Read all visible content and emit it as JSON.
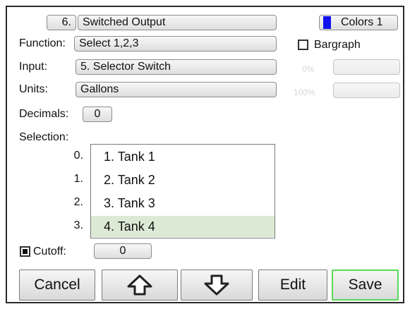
{
  "header": {
    "output_number": "6.",
    "output_name": "Switched Output",
    "colors_label": "Colors 1",
    "colors_swatch": "#1010ee"
  },
  "function": {
    "label": "Function:",
    "value": "Select 1,2,3"
  },
  "bargraph": {
    "label": "Bargraph",
    "checked": false
  },
  "input": {
    "label": "Input:",
    "value": "5. Selector Switch"
  },
  "units": {
    "label": "Units:",
    "value": "Gallons"
  },
  "range": {
    "low_label": "0%",
    "high_label": "100%",
    "low_value": "",
    "high_value": ""
  },
  "decimals": {
    "label": "Decimals:",
    "value": "0"
  },
  "selection": {
    "label": "Selection:",
    "indexes": [
      "0.",
      "1.",
      "2.",
      "3."
    ],
    "items": [
      "1. Tank 1",
      "2. Tank 2",
      "3. Tank 3",
      "4. Tank 4"
    ],
    "selected_index": 3
  },
  "cutoff": {
    "label": "Cutoff:",
    "checked": true,
    "value": "0"
  },
  "buttons": {
    "cancel": "Cancel",
    "edit": "Edit",
    "save": "Save"
  },
  "icons": {
    "up": "arrow-up-icon",
    "down": "arrow-down-icon"
  },
  "colors": {
    "save_border": "#57d957",
    "selected_row": "#dcead5"
  }
}
